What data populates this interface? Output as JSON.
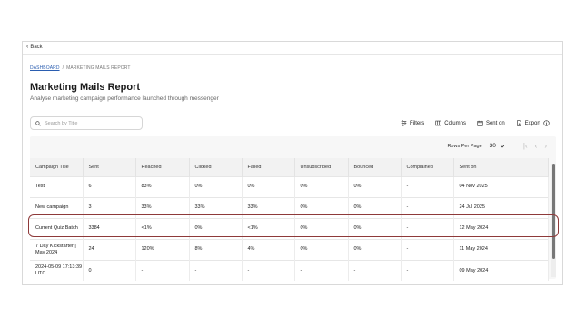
{
  "nav": {
    "back_label": "Back"
  },
  "breadcrumb": {
    "root": "DASHBOARD",
    "separator": "/",
    "current": "MARKETING MAILS REPORT"
  },
  "page": {
    "title": "Marketing Mails Report",
    "subtitle": "Analyse marketing campaign performance launched through messenger"
  },
  "search": {
    "placeholder": "Search by Title",
    "value": ""
  },
  "toolbar": {
    "filters_label": "Filters",
    "columns_label": "Columns",
    "sent_on_label": "Sent on",
    "export_label": "Export"
  },
  "pagination": {
    "rows_per_page_label": "Rows Per Page",
    "rows_per_page_value": "30"
  },
  "table": {
    "columns": [
      "Campaign Title",
      "Sent",
      "Reached",
      "Clicked",
      "Failed",
      "Unsubscribed",
      "Bounced",
      "Complained",
      "Sent on"
    ],
    "rows": [
      [
        "Test",
        "6",
        "83%",
        "0%",
        "0%",
        "0%",
        "0%",
        "-",
        "04 Nov 2025"
      ],
      [
        "New campaign",
        "3",
        "33%",
        "33%",
        "33%",
        "0%",
        "0%",
        "-",
        "24 Jul 2025"
      ],
      [
        "Current Quiz Batch",
        "3384",
        "<1%",
        "0%",
        "<1%",
        "0%",
        "0%",
        "-",
        "12 May 2024"
      ],
      [
        "7 Day Kickstarter | May 2024",
        "24",
        "120%",
        "8%",
        "4%",
        "0%",
        "0%",
        "-",
        "11 May 2024"
      ],
      [
        "2024-05-09 17:13:39 UTC",
        "0",
        "-",
        "-",
        "-",
        "-",
        "-",
        "-",
        "09 May 2024"
      ]
    ]
  },
  "colors": {
    "link": "#2a5db0",
    "highlight_ring": "#8e3a3a",
    "scrollbar_thumb": "#777777"
  }
}
